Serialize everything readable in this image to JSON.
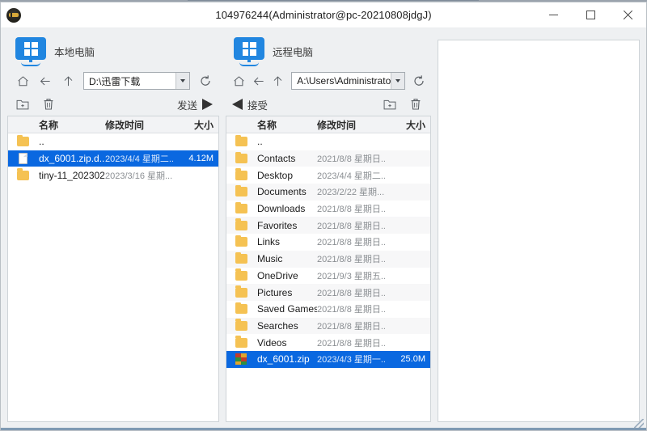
{
  "window": {
    "title": "104976244(Administrator@pc-20210808jdgJ)",
    "app_icon": "app-icon",
    "controls": {
      "minimize": "minimize",
      "maximize": "maximize",
      "close": "close"
    },
    "accent": "#0a68e0"
  },
  "local": {
    "machine_label": "本地电脑",
    "machine_icon": "windows-monitor-icon",
    "nav": {
      "home": "home-icon",
      "back": "back-arrow-icon",
      "up": "up-arrow-icon",
      "refresh": "refresh-icon",
      "path": "D:\\迅雷下载"
    },
    "actions": {
      "new_folder": "new-folder-icon",
      "delete": "trash-icon",
      "transfer_label": "发送"
    },
    "columns": {
      "name": "名称",
      "modified": "修改时间",
      "size": "大小"
    },
    "rows": [
      {
        "icon": "folder",
        "name": "..",
        "date": "",
        "size": "",
        "selected": false
      },
      {
        "icon": "file",
        "name": "dx_6001.zip.d...",
        "date": "2023/4/4 星期二...",
        "size": "4.12M",
        "selected": true
      },
      {
        "icon": "folder",
        "name": "tiny-11_202302",
        "date": "2023/3/16 星期...",
        "size": "",
        "selected": false
      }
    ]
  },
  "remote": {
    "machine_label": "远程电脑",
    "machine_icon": "windows-monitor-icon",
    "nav": {
      "home": "home-icon",
      "back": "back-arrow-icon",
      "up": "up-arrow-icon",
      "refresh": "refresh-icon",
      "path": "A:\\Users\\Administrato"
    },
    "actions": {
      "new_folder": "new-folder-icon",
      "delete": "trash-icon",
      "transfer_label": "接受"
    },
    "columns": {
      "name": "名称",
      "modified": "修改时间",
      "size": "大小"
    },
    "rows": [
      {
        "icon": "folder",
        "name": "..",
        "date": "",
        "size": "",
        "selected": false
      },
      {
        "icon": "folder",
        "name": "Contacts",
        "date": "2021/8/8 星期日...",
        "size": "",
        "selected": false
      },
      {
        "icon": "folder",
        "name": "Desktop",
        "date": "2023/4/4 星期二...",
        "size": "",
        "selected": false
      },
      {
        "icon": "folder",
        "name": "Documents",
        "date": "2023/2/22 星期...",
        "size": "",
        "selected": false
      },
      {
        "icon": "folder",
        "name": "Downloads",
        "date": "2021/8/8 星期日...",
        "size": "",
        "selected": false
      },
      {
        "icon": "folder",
        "name": "Favorites",
        "date": "2021/8/8 星期日...",
        "size": "",
        "selected": false
      },
      {
        "icon": "folder",
        "name": "Links",
        "date": "2021/8/8 星期日...",
        "size": "",
        "selected": false
      },
      {
        "icon": "folder",
        "name": "Music",
        "date": "2021/8/8 星期日...",
        "size": "",
        "selected": false
      },
      {
        "icon": "folder",
        "name": "OneDrive",
        "date": "2021/9/3 星期五...",
        "size": "",
        "selected": false
      },
      {
        "icon": "folder",
        "name": "Pictures",
        "date": "2021/8/8 星期日...",
        "size": "",
        "selected": false
      },
      {
        "icon": "folder",
        "name": "Saved Games",
        "date": "2021/8/8 星期日...",
        "size": "",
        "selected": false
      },
      {
        "icon": "folder",
        "name": "Searches",
        "date": "2021/8/8 星期日...",
        "size": "",
        "selected": false
      },
      {
        "icon": "folder",
        "name": "Videos",
        "date": "2021/8/8 星期日...",
        "size": "",
        "selected": false
      },
      {
        "icon": "zip",
        "name": "dx_6001.zip",
        "date": "2023/4/3 星期一...",
        "size": "25.0M",
        "selected": true
      }
    ]
  },
  "log": {
    "entries": []
  }
}
